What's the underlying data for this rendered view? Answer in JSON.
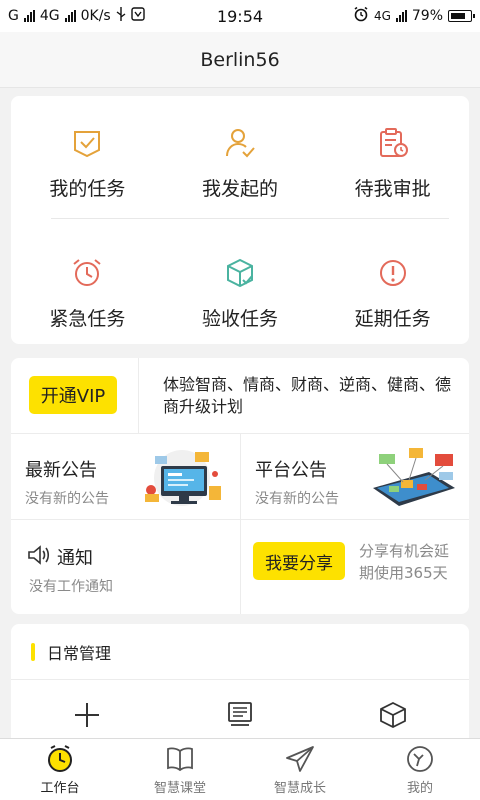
{
  "status_bar": {
    "carrier": "G",
    "network": "4G",
    "speed": "0K/s",
    "time": "19:54",
    "network_right": "4G",
    "battery": "79%"
  },
  "header": {
    "title": "Berlin56"
  },
  "tasks": {
    "row1": [
      {
        "label": "我的任务",
        "icon": "shield-check-icon",
        "color": "#e4a23a"
      },
      {
        "label": "我发起的",
        "icon": "person-check-icon",
        "color": "#e4a23a"
      },
      {
        "label": "待我审批",
        "icon": "clipboard-clock-icon",
        "color": "#e36a5a"
      }
    ],
    "row2": [
      {
        "label": "紧急任务",
        "icon": "alarm-clock-icon",
        "color": "#e36a5a"
      },
      {
        "label": "验收任务",
        "icon": "box-check-icon",
        "color": "#4ab3a0"
      },
      {
        "label": "延期任务",
        "icon": "exclamation-circle-icon",
        "color": "#e36a5a"
      }
    ]
  },
  "vip": {
    "button": "开通VIP",
    "description": "体验智商、情商、财商、逆商、健商、德商升级计划"
  },
  "notices": {
    "latest": {
      "title": "最新公告",
      "subtitle": "没有新的公告"
    },
    "platform": {
      "title": "平台公告",
      "subtitle": "没有新的公告"
    }
  },
  "notification": {
    "title": "通知",
    "subtitle": "没有工作通知"
  },
  "share": {
    "button": "我要分享",
    "description": "分享有机会延期使用365天"
  },
  "daily": {
    "title": "日常管理",
    "icons": [
      "plus-icon",
      "screen-list-icon",
      "cube-icon"
    ]
  },
  "tabbar": [
    {
      "label": "工作台",
      "icon": "clock-icon",
      "active": true
    },
    {
      "label": "智慧课堂",
      "icon": "book-icon",
      "active": false
    },
    {
      "label": "智慧成长",
      "icon": "paper-plane-icon",
      "active": false
    },
    {
      "label": "我的",
      "icon": "profile-icon",
      "active": false
    }
  ],
  "colors": {
    "accent": "#fde100",
    "background": "#f2f2f2"
  }
}
